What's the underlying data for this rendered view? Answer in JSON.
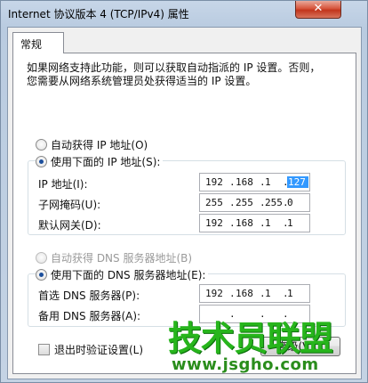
{
  "window": {
    "title": "Internet 协议版本 4 (TCP/IPv4) 属性",
    "close_label": "✕"
  },
  "tab": {
    "label": "常规"
  },
  "description": {
    "line1": "如果网络支持此功能，则可以获取自动指派的 IP 设置。否则，",
    "line2": "您需要从网络系统管理员处获得适当的 IP 设置。"
  },
  "ip_section": {
    "auto_label": "自动获得 IP 地址(O)",
    "auto_selected": false,
    "manual_label": "使用下面的 IP 地址(S):",
    "manual_selected": true,
    "fields": [
      {
        "label": "IP 地址(I):",
        "octets": [
          "192",
          "168",
          "1",
          "127"
        ]
      },
      {
        "label": "子网掩码(U):",
        "octets": [
          "255",
          "255",
          "255",
          "0"
        ]
      },
      {
        "label": "默认网关(D):",
        "octets": [
          "192",
          "168",
          "1",
          "1"
        ]
      }
    ]
  },
  "dns_section": {
    "auto_label": "自动获得 DNS 服务器地址(B)",
    "auto_selected": false,
    "auto_disabled": true,
    "manual_label": "使用下面的 DNS 服务器地址(E):",
    "manual_selected": true,
    "fields": [
      {
        "label": "首选 DNS 服务器(P):",
        "octets": [
          "192",
          "168",
          "1",
          "1"
        ]
      },
      {
        "label": "备用 DNS 服务器(A):",
        "octets": [
          "",
          "",
          "",
          ""
        ]
      }
    ]
  },
  "validate_checkbox": {
    "label": "退出时验证设置(L)",
    "checked": false
  },
  "advanced_button": {
    "label": "高级(V)..."
  },
  "watermark": {
    "text": "技术员联盟",
    "url": "www.jsgho.com"
  },
  "colors": {
    "selection": "#3399ff",
    "close_button": "#c1351c",
    "watermark": "#27b51c"
  }
}
